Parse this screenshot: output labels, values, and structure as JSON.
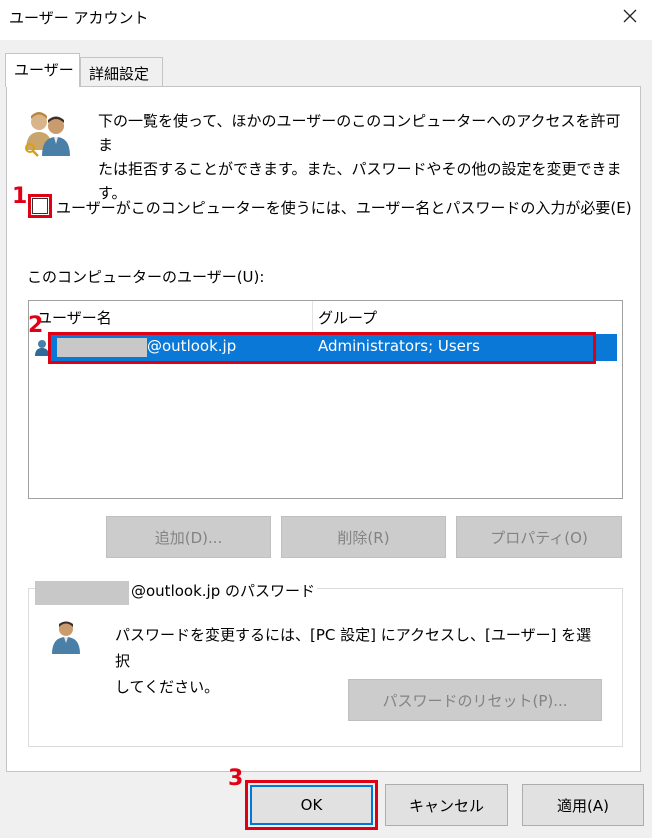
{
  "window": {
    "title": "ユーザー アカウント"
  },
  "tabs": [
    {
      "label": "ユーザー"
    },
    {
      "label": "詳細設定"
    }
  ],
  "description": {
    "line1": "下の一覧を使って、ほかのユーザーのこのコンピューターへのアクセスを許可ま",
    "line2": "たは拒否することができます。また、パスワードやその他の設定を変更できま",
    "line3": "す。"
  },
  "require_login": {
    "label": "ユーザーがこのコンピューターを使うには、ユーザー名とパスワードの入力が必要(E)",
    "checked": false
  },
  "users_list": {
    "label": "このコンピューターのユーザー(U):",
    "columns": [
      "ユーザー名",
      "グループ"
    ],
    "rows": [
      {
        "user": "@outlook.jp",
        "group": "Administrators; Users",
        "selected": true
      }
    ]
  },
  "list_buttons": {
    "add": "追加(D)...",
    "remove": "削除(R)",
    "properties": "プロパティ(O)"
  },
  "password_group": {
    "legend": "@outlook.jp のパスワード",
    "line1": "パスワードを変更するには、[PC 設定] にアクセスし、[ユーザー] を選択",
    "line2": "してください。",
    "reset_button": "パスワードのリセット(P)..."
  },
  "dialog_buttons": {
    "ok": "OK",
    "cancel": "キャンセル",
    "apply": "適用(A)"
  },
  "callouts": [
    "1",
    "2",
    "3"
  ],
  "colors": {
    "selection": "#0a78d7",
    "highlight": "#e00014",
    "ok_border": "#0078d7"
  }
}
